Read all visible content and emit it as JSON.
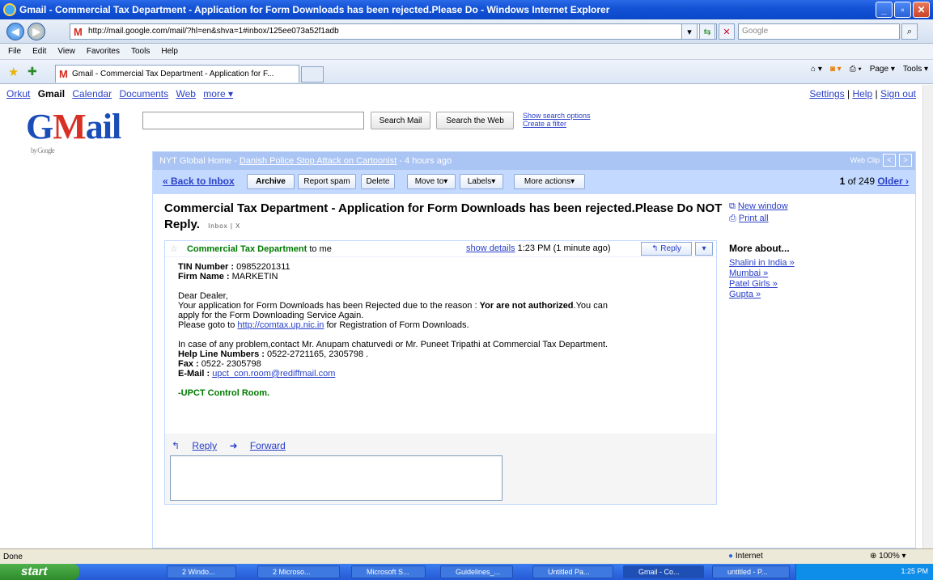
{
  "window": {
    "title": "Gmail - Commercial Tax Department - Application for Form Downloads has been rejected.Please Do  - Windows Internet Explorer"
  },
  "address": {
    "url": "http://mail.google.com/mail/?hl=en&shva=1#inbox/125ee073a52f1adb",
    "search_placeholder": "Google"
  },
  "menu": [
    "File",
    "Edit",
    "View",
    "Favorites",
    "Tools",
    "Help"
  ],
  "tab": {
    "label": "Gmail - Commercial Tax Department - Application for F...",
    "cmd": [
      "Page ▾",
      "Tools ▾"
    ]
  },
  "gbar": {
    "items": [
      "Orkut",
      "Gmail",
      "Calendar",
      "Documents",
      "Web",
      "more ▾"
    ],
    "settings": "Settings",
    "help": "Help",
    "signout": "Sign out"
  },
  "logo": {
    "text_g": "G",
    "text_m": "M",
    "text_rest": "ail",
    "by": "by Google"
  },
  "search": {
    "mail_btn": "Search Mail",
    "web_btn": "Search the Web",
    "options": "Show search options",
    "filter": "Create a filter"
  },
  "webclip": {
    "source": "NYT Global Home - ",
    "headline": "Danish Police Stop Attack on Cartoonist",
    "age": " - 4 hours ago",
    "label": "Web Clip"
  },
  "actions": {
    "back": "« Back to Inbox",
    "archive": "Archive",
    "spam": "Report spam",
    "delete": "Delete",
    "move": "Move to▾",
    "labels": "Labels▾",
    "more": "More actions▾",
    "paging_count": "1",
    "paging_of": " of 249 ",
    "older": "Older ›"
  },
  "mail": {
    "subject": "Commercial Tax Department - Application for Form Downloads has been rejected.Please Do NOT Reply.",
    "inbox_label": "Inbox | X",
    "new_window": "New window",
    "print_all": "Print all",
    "more_about": "More about...",
    "more_links": [
      "Shalini in India »",
      "Mumbai »",
      "Patel Girls »",
      "Gupta »"
    ],
    "sender": "Commercial Tax Department",
    "to": " to me",
    "show_details": "show details",
    "time": " 1:23 PM (1 minute ago)",
    "reply_btn": "Reply",
    "tin_label": "TIN Number :",
    "tin_value": " 098522013",
    "tin_suffix": "11",
    "firm_label": "Firm Name :",
    "firm_value": " MARKETIN",
    "greeting": "Dear Dealer,",
    "line1_a": "Your application for Form Downloads has been Rejected due to the reason : ",
    "line1_b": "Yor are not authorized",
    "line1_c": ".You can",
    "line2": "apply for the Form Downloading Service Again.",
    "line3_a": "Please goto to ",
    "line3_link": "http://comtax.up.nic.in",
    "line3_b": " for Registration of Form Downloads.",
    "line4": "In case of any problem,contact Mr. Anupam chaturvedi or Mr. Puneet Tripathi at Commercial Tax Department.",
    "helpline_label": "Help Line Numbers :",
    "helpline_value": " 0522-2721165, 2305798 .",
    "fax_label": "Fax :",
    "fax_value": " 0522- 2305798",
    "email_label": "E-Mail :",
    "email_value": "upct_con.room@rediffmail.com",
    "signature": "-UPCT Control Room.",
    "reply_link": "Reply",
    "forward_link": "Forward"
  },
  "status": {
    "left": "Done",
    "zone": "Internet",
    "zoom": "100%"
  },
  "taskbar": {
    "start": "start",
    "tasks": [
      "2 Windo...",
      "2 Microso...",
      "Microsoft S...",
      "Guidelines_...",
      "Untitled Pa...",
      "Gmail - Co...",
      "untitled - P..."
    ],
    "clock": "1:25 PM"
  },
  "colors": {
    "gmail_blue": "#c3d9ff",
    "link": "#2a40c9",
    "sender_green": "#007a00"
  }
}
